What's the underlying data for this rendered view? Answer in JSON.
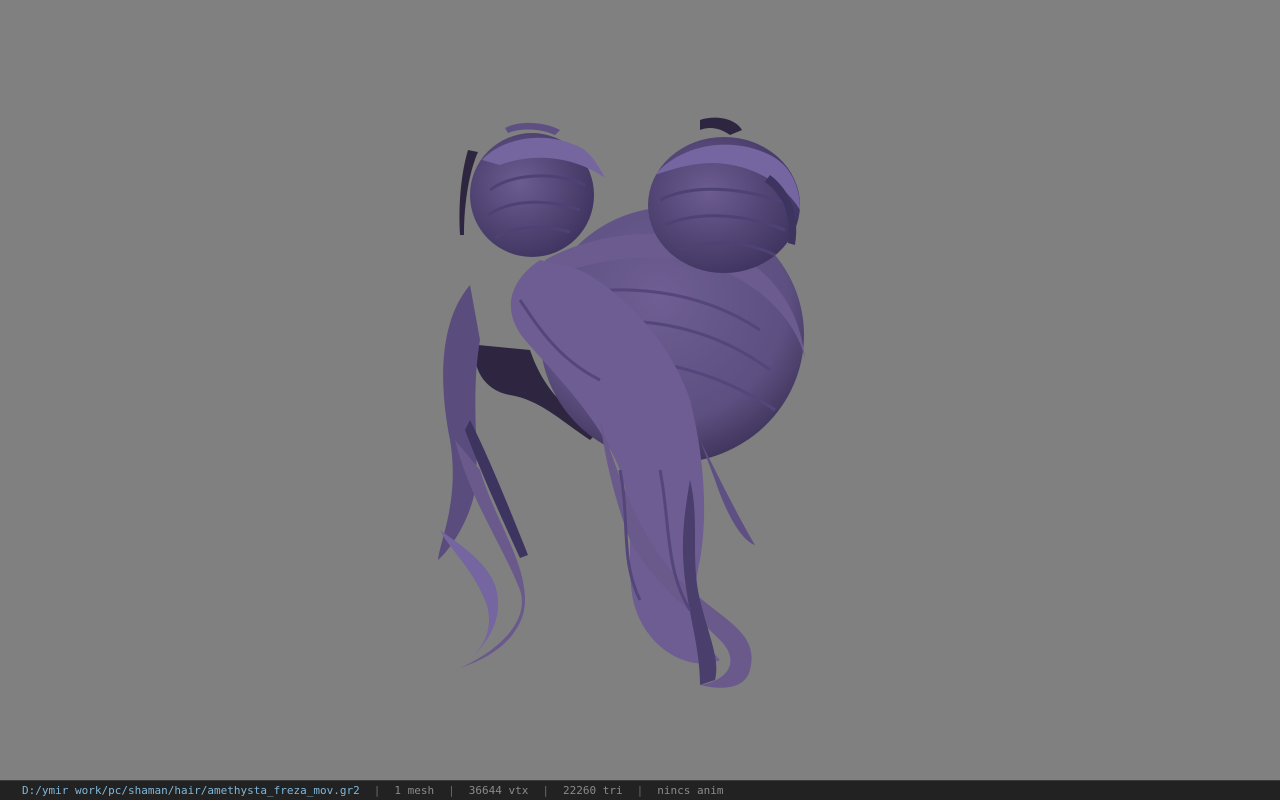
{
  "viewport": {
    "background_color": "#808080",
    "model": {
      "name": "amethysta_freza_mov",
      "hair_color": "#6a5a8c",
      "shadow_color": "#2e2640"
    }
  },
  "statusbar": {
    "file_path": "D:/ymir work/pc/shaman/hair/amethysta_freza_mov.gr2",
    "separator": "|",
    "mesh_count": "1 mesh",
    "vertex_count": "36644 vtx",
    "triangle_count": "22260 tri",
    "anim_status": "nincs anim"
  }
}
